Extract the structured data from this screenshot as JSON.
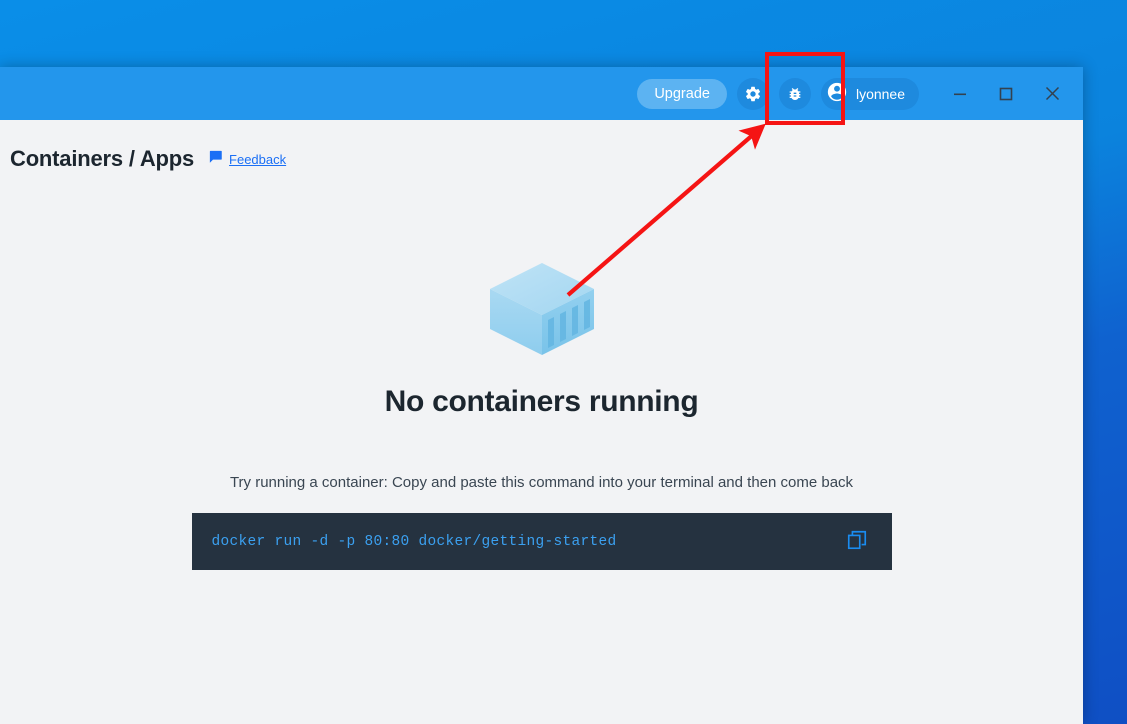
{
  "window": {
    "titlebar": {
      "upgrade_label": "Upgrade",
      "settings_icon": "gear-icon",
      "troubleshoot_icon": "bug-icon",
      "account_icon": "account-circle-icon",
      "account_name": "lyonnee",
      "minimize_label": "Minimize",
      "maximize_label": "Maximize",
      "close_label": "Close"
    },
    "colors": {
      "titlebar_blue": "#2396ec",
      "upgrade_blue": "#5cb3f2",
      "icon_button_blue": "#1e8ade",
      "content_gray": "#f2f3f5",
      "command_box_dark": "#253240",
      "command_text_blue": "#3ba0f0",
      "link_blue": "#1b6ff5",
      "annotation_red": "#f51414"
    }
  },
  "page": {
    "title": "Containers / Apps",
    "feedback_icon": "speech-bubble-icon",
    "feedback_label": "Feedback"
  },
  "empty_state": {
    "illustration": "container-box-icon",
    "heading": "No containers running",
    "subtitle": "Try running a container: Copy and paste this command into your terminal and then come back",
    "command": "docker run -d -p 80:80 docker/getting-started",
    "copy_icon": "copy-icon"
  },
  "annotations": {
    "highlight_box_label": "highlight-around-troubleshoot-button",
    "arrow_label": "pointer-arrow-to-troubleshoot-button"
  }
}
